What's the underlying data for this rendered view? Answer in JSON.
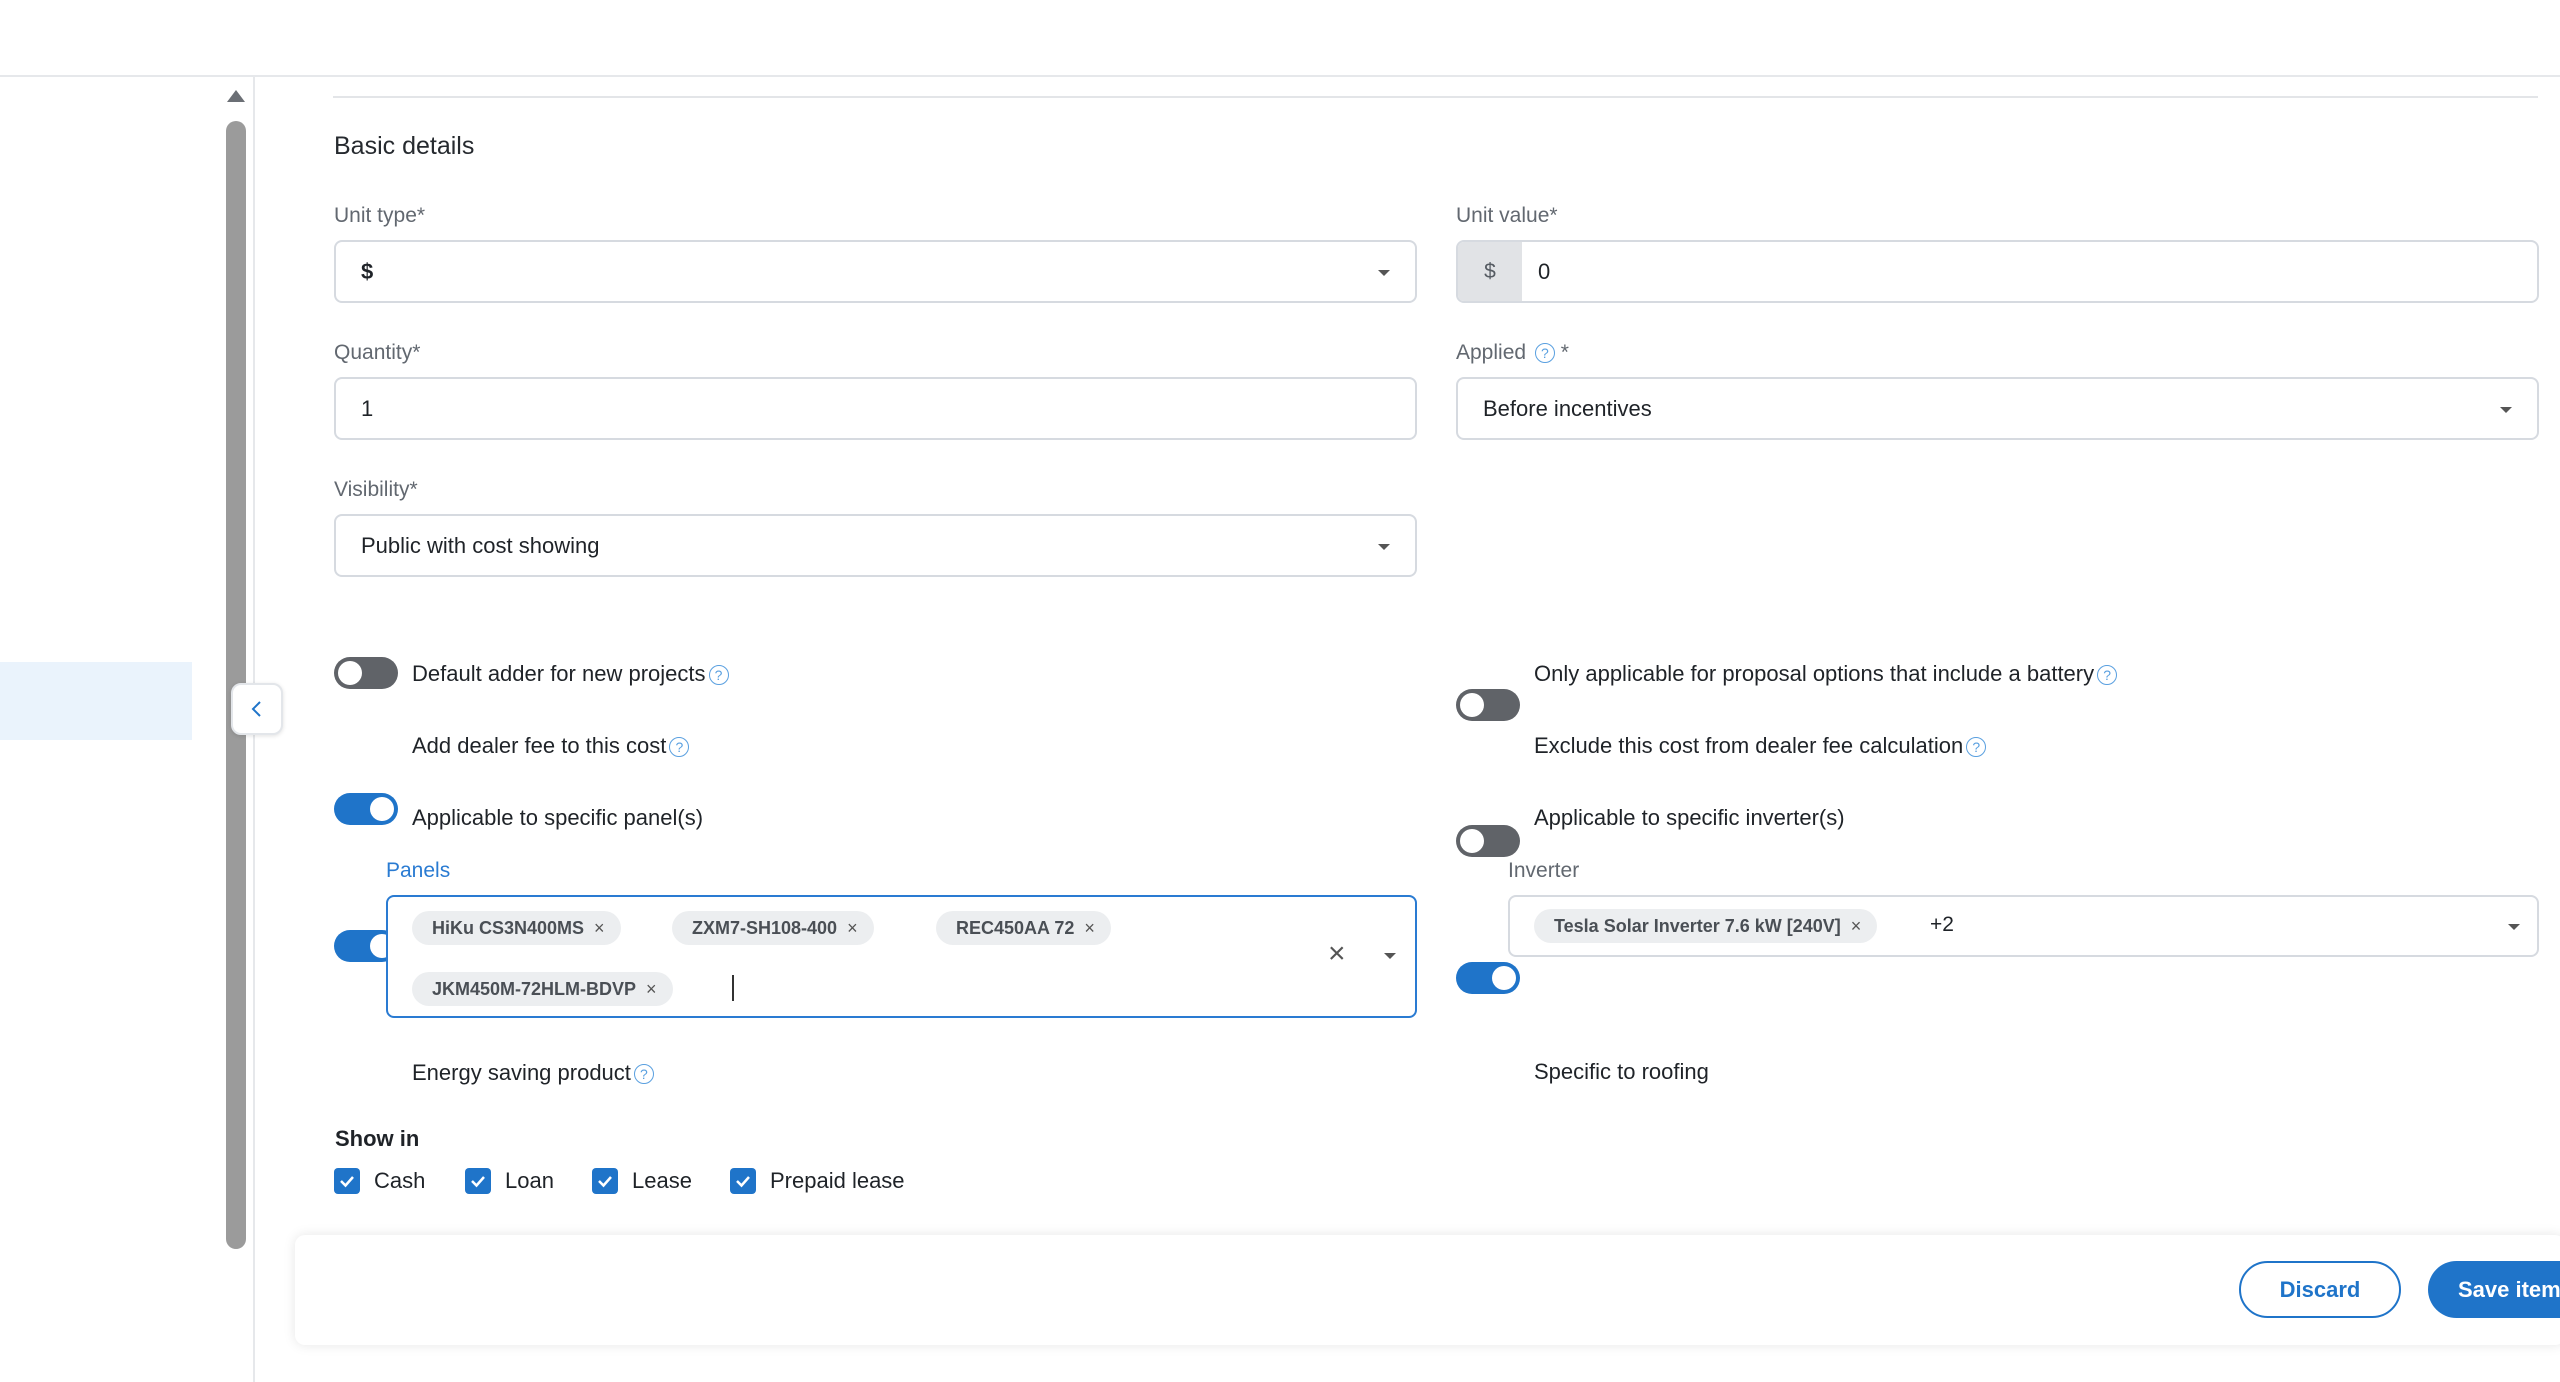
{
  "section": {
    "title": "Basic details"
  },
  "fields": {
    "unit_type": {
      "label": "Unit type*",
      "value": "$"
    },
    "unit_value": {
      "label": "Unit value*",
      "prefix": "$",
      "value": "0"
    },
    "quantity": {
      "label": "Quantity*",
      "value": "1"
    },
    "applied": {
      "label": "Applied",
      "required_mark": "*",
      "value": "Before incentives"
    },
    "visibility": {
      "label": "Visibility*",
      "value": "Public with cost showing"
    }
  },
  "toggles": {
    "default_adder": {
      "label": "Default adder for new projects",
      "on": false
    },
    "battery_only": {
      "label": "Only applicable for proposal options that include a battery",
      "on": false
    },
    "dealer_fee": {
      "label": "Add dealer fee to this cost",
      "on": true
    },
    "exclude_dealer_fee": {
      "label": "Exclude this cost from dealer fee calculation",
      "on": false
    },
    "specific_panels": {
      "label": "Applicable to specific panel(s)",
      "on": true
    },
    "specific_inverters": {
      "label": "Applicable to specific inverter(s)",
      "on": true
    },
    "energy_saving": {
      "label": "Energy saving product",
      "on": false
    },
    "roofing": {
      "label": "Specific to roofing",
      "on": false
    }
  },
  "panels": {
    "label": "Panels",
    "chips": [
      "HiKu CS3N400MS",
      "ZXM7-SH108-400",
      "REC450AA 72",
      "JKM450M-72HLM-BDVP"
    ]
  },
  "inverter": {
    "label": "Inverter",
    "chip": "Tesla Solar Inverter 7.6 kW [240V]",
    "more": "+2"
  },
  "show_in": {
    "label": "Show in",
    "options": [
      "Cash",
      "Loan",
      "Lease",
      "Prepaid lease"
    ]
  },
  "footer": {
    "discard": "Discard",
    "save": "Save item"
  },
  "icons": {
    "help": "?",
    "chip_remove": "×",
    "clear": "×"
  },
  "colors": {
    "accent": "#1f74c9",
    "toggle_off": "#606368"
  }
}
